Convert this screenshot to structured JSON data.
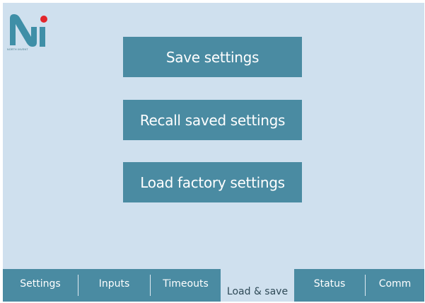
{
  "logo": {
    "icon": "ni-logo",
    "wordmark": "NORTH INVENT",
    "colors": {
      "letter": "#3f8fa7",
      "dot": "#e3262b"
    }
  },
  "actions": {
    "save_label": "Save settings",
    "recall_label": "Recall saved settings",
    "factory_label": "Load factory settings"
  },
  "tabs": [
    {
      "label": "Settings",
      "active": false
    },
    {
      "label": "Inputs",
      "active": false
    },
    {
      "label": "Timeouts",
      "active": false
    },
    {
      "label": "Load & save",
      "active": true
    },
    {
      "label": "Status",
      "active": false
    },
    {
      "label": "Comm",
      "active": false
    }
  ],
  "colors": {
    "background": "#cfe0ee",
    "accent": "#4a8ba2",
    "text_on_accent": "#ffffff"
  }
}
